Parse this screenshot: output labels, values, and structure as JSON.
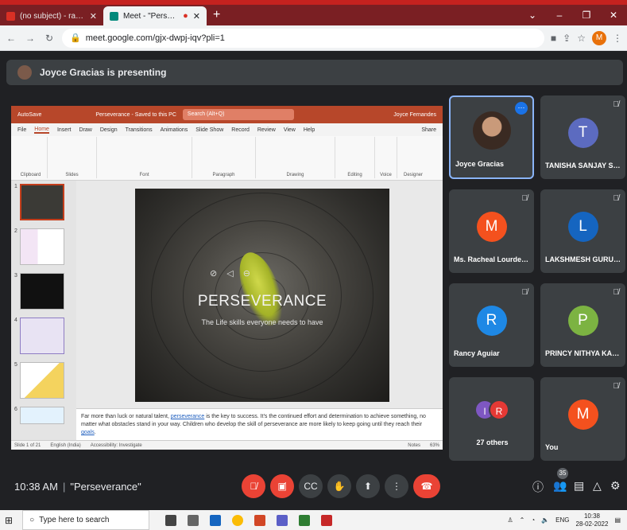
{
  "browser": {
    "tabs": [
      {
        "title": "(no subject) - racheal.goes@vvm",
        "favicon_color": "#d93025"
      },
      {
        "title": "Meet - \"Perseverance\"",
        "favicon_color": "#00897b"
      }
    ],
    "url": "meet.google.com/gjx-dwpj-iqv?pli=1",
    "profile_initial": "M"
  },
  "banner": {
    "text": "Joyce Gracias is presenting"
  },
  "ppt": {
    "title_center": "Perseverance - Saved to this PC",
    "search_placeholder": "Search (Alt+Q)",
    "user": "Joyce Fernandes",
    "autosave": "AutoSave",
    "share": "Share",
    "menu_tabs": [
      "File",
      "Home",
      "Insert",
      "Draw",
      "Design",
      "Transitions",
      "Animations",
      "Slide Show",
      "Record",
      "Review",
      "View",
      "Help"
    ],
    "active_tab": "Home",
    "ribbon_groups": [
      "Clipboard",
      "Slides",
      "Font",
      "Paragraph",
      "Drawing",
      "Editing",
      "Voice",
      "Designer"
    ],
    "thumbnail_numbers": [
      "1",
      "2",
      "3",
      "4",
      "5",
      "6"
    ],
    "slide": {
      "title": "PERSEVERANCE",
      "subtitle": "The Life skills everyone needs to have"
    },
    "notes": {
      "before": "Far more than luck or natural talent, ",
      "link1": "perseverance",
      "middle": " is the key to success. It's the continued effort and determination to achieve something, no matter what obstacles stand in your way. Children who develop the skill of perseverance are more likely to keep going until they reach their ",
      "link2": "goals",
      "after": "."
    },
    "status": {
      "slide": "Slide 1 of 21",
      "lang": "English (India)",
      "accessibility": "Accessibility: Investigate",
      "notes_label": "Notes",
      "zoom": "63%"
    }
  },
  "participants": [
    {
      "name": "Joyce Gracias",
      "initial": "",
      "color": "#3c4043",
      "presenter": true
    },
    {
      "name": "TANISHA SANJAY SHIROD...",
      "initial": "T",
      "color": "#5c6bc0",
      "muted": true
    },
    {
      "name": "Ms. Racheal Lourdes Goes",
      "initial": "M",
      "color": "#f4511e",
      "muted": true
    },
    {
      "name": "LAKSHMESH GURUDAS V...",
      "initial": "L",
      "color": "#1565c0",
      "muted": true
    },
    {
      "name": "Rancy Aguiar",
      "initial": "R",
      "color": "#1e88e5",
      "muted": true
    },
    {
      "name": "PRINCY NITHYA KANNADY",
      "initial": "P",
      "color": "#7cb342",
      "muted": true
    },
    {
      "name": "27 others",
      "initials": [
        "I",
        "R"
      ],
      "colors": [
        "#7e57c2",
        "#e53935"
      ]
    },
    {
      "name": "You",
      "initial": "M",
      "color": "#f4511e",
      "muted": true
    }
  ],
  "controls": {
    "time": "10:38 AM",
    "meeting": "\"Perseverance\"",
    "people_count": "35"
  },
  "taskbar": {
    "search_placeholder": "Type here to search",
    "lang": "ENG",
    "time": "10:38",
    "date": "28-02-2022"
  }
}
